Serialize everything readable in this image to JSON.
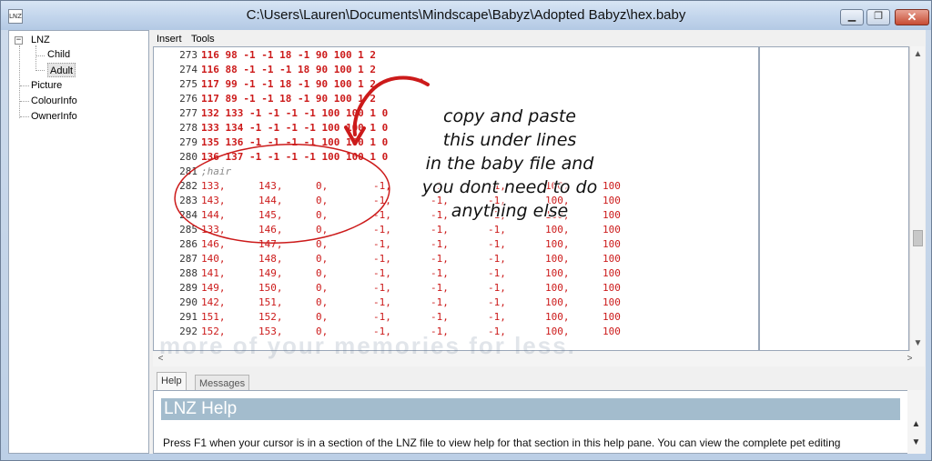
{
  "window": {
    "title": "C:\\Users\\Lauren\\Documents\\Mindscape\\Babyz\\Adopted Babyz\\hex.baby",
    "icon_label": "LNZ",
    "minimize_glyph": "▁",
    "maximize_glyph": "❐",
    "close_glyph": "✕"
  },
  "tree": {
    "root": {
      "label": "LNZ",
      "expander": "−"
    },
    "children": [
      {
        "label": "Child",
        "selected": false
      },
      {
        "label": "Adult",
        "selected": true
      }
    ],
    "siblings": [
      {
        "label": "Picture"
      },
      {
        "label": "ColourInfo"
      },
      {
        "label": "OwnerInfo"
      }
    ]
  },
  "menu": {
    "insert": "Insert",
    "tools": "Tools"
  },
  "editor": {
    "lines": [
      {
        "n": "273",
        "text": "116 98 -1 -1 18 -1 90 100 1 2",
        "style": "bold"
      },
      {
        "n": "274",
        "text": "116 88 -1 -1 -1 18 90 100 1 2",
        "style": "bold"
      },
      {
        "n": "275",
        "text": "117 99 -1 -1 18 -1 90 100 1 2",
        "style": "bold"
      },
      {
        "n": "276",
        "text": "117 89 -1 -1 18 -1 90 100 1 2",
        "style": "bold"
      },
      {
        "n": "277",
        "text": "132 133 -1 -1 -1 -1 100 100 1 0",
        "style": "bold"
      },
      {
        "n": "278",
        "text": "133 134 -1 -1 -1 -1 100 100 1 0",
        "style": "bold"
      },
      {
        "n": "279",
        "text": "135 136 -1 -1 -1 -1 100 100 1 0",
        "style": "bold"
      },
      {
        "n": "280",
        "text": "136 137 -1 -1 -1 -1 100 100 1 0",
        "style": "bold"
      },
      {
        "n": "281",
        "text": ";hair",
        "style": "comment"
      },
      {
        "n": "282",
        "cells": [
          "133,",
          "143,",
          "0,",
          "-1,",
          "-1,",
          "-1,",
          "100,",
          "100"
        ],
        "style": "table"
      },
      {
        "n": "283",
        "cells": [
          "143,",
          "144,",
          "0,",
          "-1,",
          "-1,",
          "-1,",
          "100,",
          "100"
        ],
        "style": "table"
      },
      {
        "n": "284",
        "cells": [
          "144,",
          "145,",
          "0,",
          "-1,",
          "-1,",
          "-1,",
          "100,",
          "100"
        ],
        "style": "table"
      },
      {
        "n": "285",
        "cells": [
          "133,",
          "146,",
          "0,",
          "-1,",
          "-1,",
          "-1,",
          "100,",
          "100"
        ],
        "style": "table"
      },
      {
        "n": "286",
        "cells": [
          "146,",
          "147,",
          "0,",
          "-1,",
          "-1,",
          "-1,",
          "100,",
          "100"
        ],
        "style": "table"
      },
      {
        "n": "287",
        "cells": [
          "140,",
          "148,",
          "0,",
          "-1,",
          "-1,",
          "-1,",
          "100,",
          "100"
        ],
        "style": "table"
      },
      {
        "n": "288",
        "cells": [
          "141,",
          "149,",
          "0,",
          "-1,",
          "-1,",
          "-1,",
          "100,",
          "100"
        ],
        "style": "table"
      },
      {
        "n": "289",
        "cells": [
          "149,",
          "150,",
          "0,",
          "-1,",
          "-1,",
          "-1,",
          "100,",
          "100"
        ],
        "style": "table"
      },
      {
        "n": "290",
        "cells": [
          "142,",
          "151,",
          "0,",
          "-1,",
          "-1,",
          "-1,",
          "100,",
          "100"
        ],
        "style": "table"
      },
      {
        "n": "291",
        "cells": [
          "151,",
          "152,",
          "0,",
          "-1,",
          "-1,",
          "-1,",
          "100,",
          "100"
        ],
        "style": "table"
      },
      {
        "n": "292",
        "cells": [
          "152,",
          "153,",
          "0,",
          "-1,",
          "-1,",
          "-1,",
          "100,",
          "100"
        ],
        "style": "table"
      }
    ]
  },
  "scroll": {
    "up": "▲",
    "down": "▼",
    "left": "<",
    "right": ">"
  },
  "tabs": {
    "help": "Help",
    "messages": "Messages"
  },
  "help": {
    "heading": "LNZ Help",
    "text": "Press F1 when your cursor is in a section of the LNZ file to view help for that section in this help pane. You can view the complete pet editing"
  },
  "annotation": {
    "lines": [
      "copy and paste",
      "this under lines",
      "in the baby file and",
      "you dont need to do",
      "anything else"
    ],
    "color": "#cc1a1a"
  },
  "watermark": "more of your memories for less."
}
